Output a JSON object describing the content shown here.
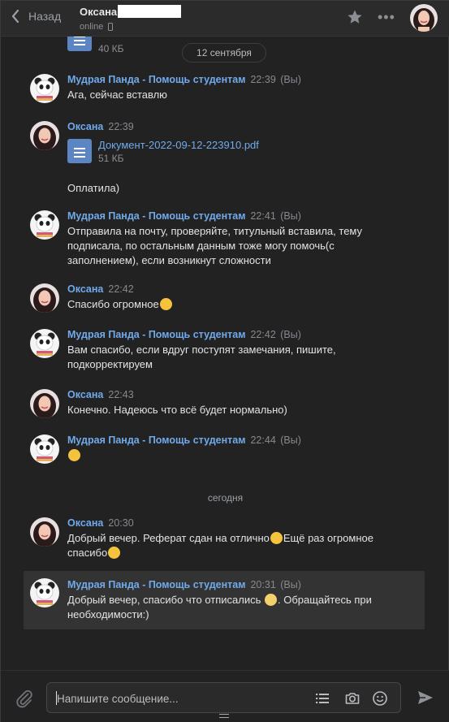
{
  "header": {
    "back_label": "Назад",
    "peer_name": "Оксана",
    "peer_status": "online"
  },
  "top_file": {
    "size": "40 КБ"
  },
  "date_pill": "12 сентября",
  "today_label": "сегодня",
  "messages": [
    {
      "author": "Мудрая Панда - Помощь студентам",
      "time": "22:39",
      "suffix": "(Вы)",
      "text": "Ага, сейчас вставлю"
    },
    {
      "author": "Оксана",
      "time": "22:39",
      "file_name": "Документ-2022-09-12-223910.pdf",
      "file_size": "51 КБ",
      "text": "Оплатила)"
    },
    {
      "author": "Мудрая Панда - Помощь студентам",
      "time": "22:41",
      "suffix": "(Вы)",
      "text": "Отправила на почту, проверяйте, титульный вставила, тему подписала, по остальным данным тоже могу помочь(с заполнением), если возникнут сложности"
    },
    {
      "author": "Оксана",
      "time": "22:42",
      "text": "Спасибо огромное"
    },
    {
      "author": "Мудрая Панда - Помощь студентам",
      "time": "22:42",
      "suffix": "(Вы)",
      "text": "Вам спасибо, если вдруг поступят замечания, пишите, подкорректируем"
    },
    {
      "author": "Оксана",
      "time": "22:43",
      "text": "Конечно. Надеюсь что всё будет нормально)"
    },
    {
      "author": "Мудрая Панда - Помощь студентам",
      "time": "22:44",
      "suffix": "(Вы)"
    },
    {
      "author": "Оксана",
      "time": "20:30",
      "text_a": "Добрый вечер. Реферат сдан на отлично",
      "text_b": "Ещё раз огромное спасибо"
    },
    {
      "author": "Мудрая Панда - Помощь студентам",
      "time": "20:31",
      "suffix": "(Вы)",
      "text_a": "Добрый вечер, спасибо что отписались ",
      "text_b": ". Обращайтесь при необходимости:)"
    }
  ],
  "composer": {
    "placeholder": "Напишите сообщение..."
  },
  "colors": {
    "accent": "#71aaeb",
    "background": "#222222",
    "file_icon": "#5b86c3"
  }
}
